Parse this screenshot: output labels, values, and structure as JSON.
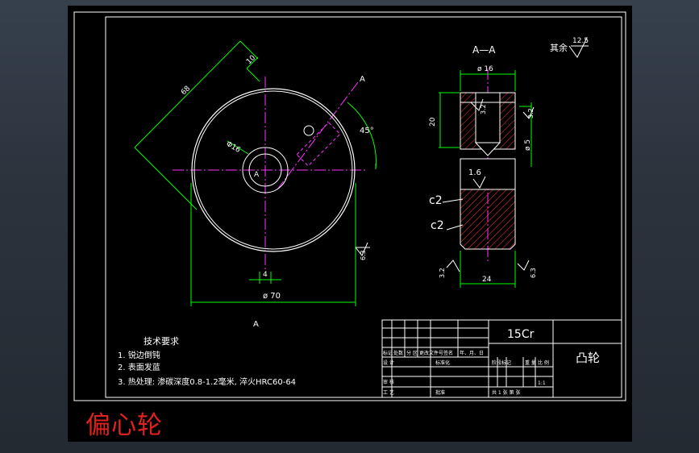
{
  "section": {
    "label": "A—A",
    "cut_a_top": "A",
    "cut_a_bottom": "A",
    "center_a": "A"
  },
  "dims": {
    "d68": "68",
    "d10": "10",
    "angle": "45°",
    "phi16_front": "Φ16",
    "phi70": "ø 70",
    "d4": "4",
    "phi16_side": "ø 16",
    "d20": "20",
    "phi5": "ø 5",
    "d24": "24",
    "c2_a": "c2",
    "c2_b": "c2"
  },
  "roughness": {
    "qiyu_label": "其余",
    "qiyu_value": "12.5",
    "top_right": "3.2",
    "mid": "1.6",
    "bottom_left": "3.2",
    "bottom_right": "6.3",
    "front_right": "6.3",
    "top_center": "3.2"
  },
  "requirements": {
    "title": "技术要求",
    "items": [
      "1. 锐边倒钝",
      "2. 表面发蓝",
      "3. 热处理: 渗碳深度0.8-1.2毫米, 淬火HRC60-64"
    ]
  },
  "title_block": {
    "material": "15Cr",
    "part_name": "凸轮",
    "hdr_biaoji": "标记",
    "hdr_chushu": "处数",
    "hdr_fenqu": "分 区",
    "hdr_wenjian": "更改文件号签名",
    "hdr_date": "年、月、日",
    "sheji": "设 计",
    "shenhe": "审 核",
    "gongyi": "工 艺",
    "biaozhunhua": "标准化",
    "pizhun": "批准",
    "jieduan": "阶段标记",
    "zhongliang": "重 量",
    "bili": "比 例",
    "scale": "1:1",
    "sheets": "共 1 张   第   张"
  },
  "caption": "偏心轮"
}
